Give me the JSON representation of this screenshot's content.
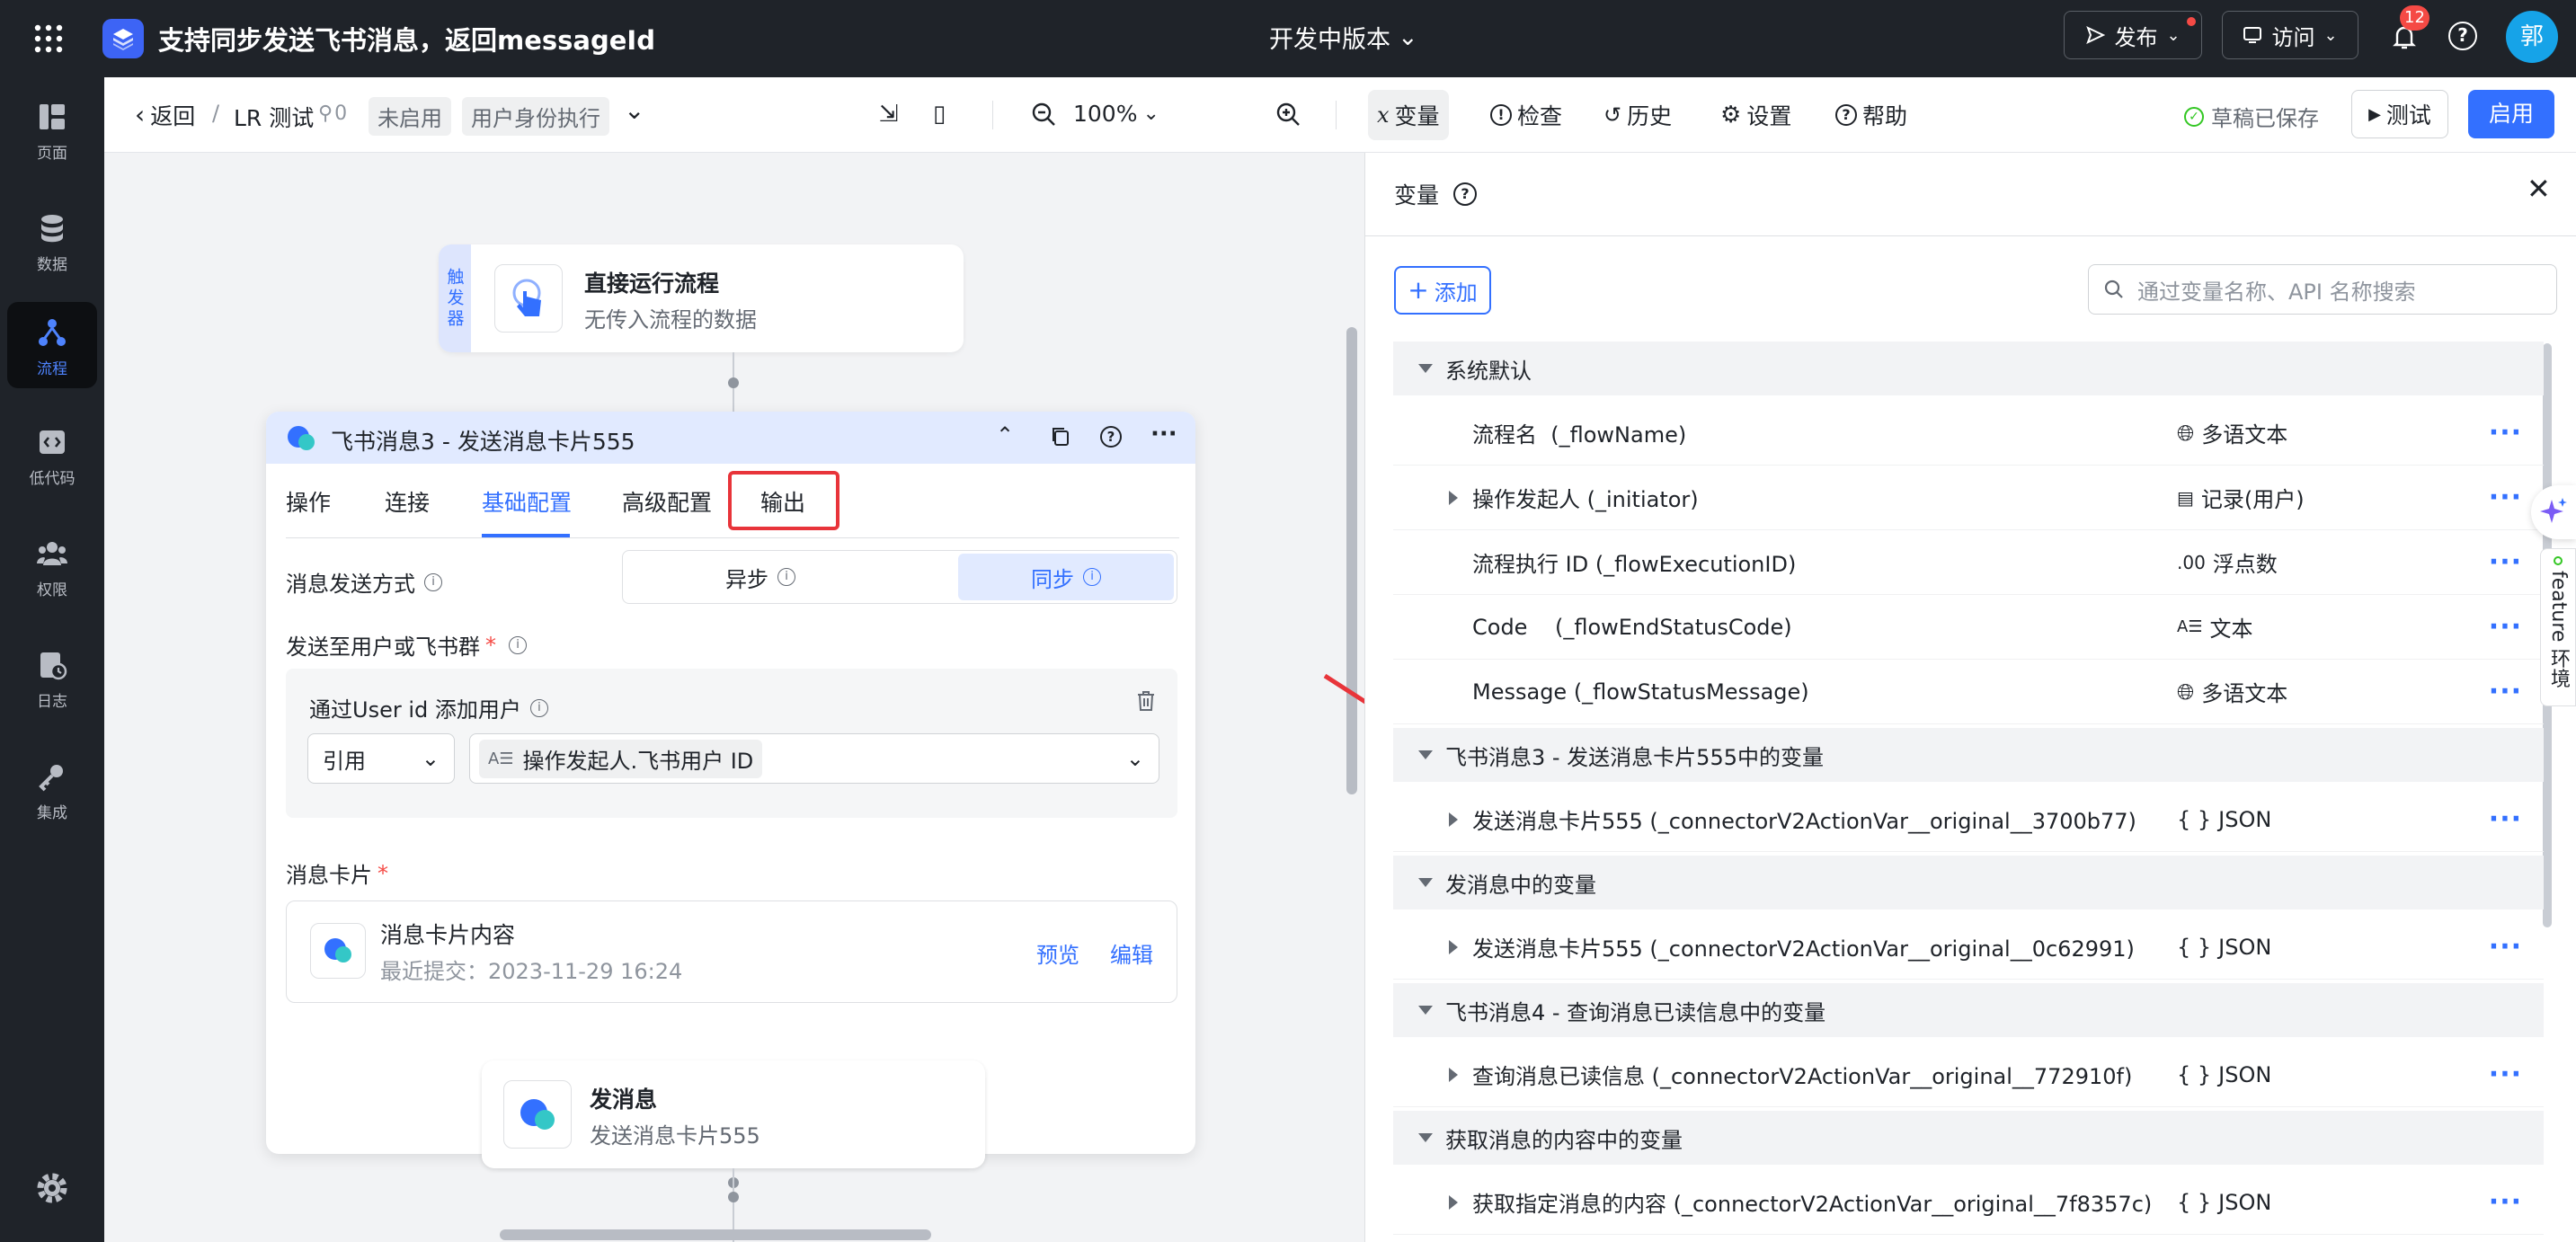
{
  "app": {
    "title": "支持同步发送飞书消息，返回messageId",
    "version_label": "开发中版本",
    "publish_label": "发布",
    "visit_label": "访问",
    "notification_count": "12",
    "avatar_text": "郭"
  },
  "sidebar": {
    "items": [
      {
        "label": "页面",
        "icon": "page-icon"
      },
      {
        "label": "数据",
        "icon": "database-icon"
      },
      {
        "label": "流程",
        "icon": "flow-icon"
      },
      {
        "label": "低代码",
        "icon": "code-icon"
      },
      {
        "label": "权限",
        "icon": "users-icon"
      },
      {
        "label": "日志",
        "icon": "log-icon"
      },
      {
        "label": "集成",
        "icon": "key-icon"
      }
    ]
  },
  "toolbar": {
    "back_label": "返回",
    "breadcrumb_sep": "/",
    "flow_name": "LR 测试",
    "link_count": "0",
    "status_tag": "未启用",
    "exec_tag": "用户身份执行",
    "zoom": "100%",
    "variables": "变量",
    "check": "检查",
    "history": "历史",
    "settings": "设置",
    "help": "帮助",
    "saved": "草稿已保存",
    "test": "测试",
    "enable": "启用"
  },
  "canvas": {
    "trigger_badge": "触发器",
    "trigger_title": "直接运行流程",
    "trigger_sub": "无传入流程的数据",
    "node_title": "飞书消息3 - 发送消息卡片555",
    "tabs": [
      "操作",
      "连接",
      "基础配置",
      "高级配置",
      "输出"
    ],
    "send_mode_label": "消息发送方式",
    "mode_async": "异步",
    "mode_sync": "同步",
    "send_to_label": "发送至用户或飞书群",
    "required_mark": "*",
    "add_user_label": "通过User id 添加用户",
    "ref_select": "引用",
    "ref_value": "操作发起人.飞书用户 ID",
    "card_label": "消息卡片",
    "card_title": "消息卡片内容",
    "card_sub": "最近提交：2023-11-29 16:24",
    "preview": "预览",
    "edit": "编辑",
    "next_title": "发消息",
    "next_sub": "发送消息卡片555"
  },
  "panel": {
    "title": "变量",
    "add_label": "添加",
    "search_placeholder": "通过变量名称、API 名称搜索",
    "groups": [
      {
        "label": "系统默认"
      },
      {
        "label": "飞书消息3 - 发送消息卡片555中的变量"
      },
      {
        "label": "发消息中的变量"
      },
      {
        "label": "飞书消息4 - 查询消息已读信息中的变量"
      },
      {
        "label": "获取消息的内容中的变量"
      }
    ],
    "rows": [
      {
        "name": "流程名  (_flowName)",
        "type": "多语文本",
        "icon": "globe-icon",
        "expand": false
      },
      {
        "name": "操作发起人 (_initiator)",
        "type": "记录(用户)",
        "icon": "record-icon",
        "expand": true
      },
      {
        "name": "流程执行 ID (_flowExecutionID)",
        "type": "浮点数",
        "icon": "decimal-icon",
        "expand": false
      },
      {
        "name": "Code    (_flowEndStatusCode)",
        "type": "文本",
        "icon": "text-icon",
        "expand": false
      },
      {
        "name": "Message (_flowStatusMessage)",
        "type": "多语文本",
        "icon": "globe-icon",
        "expand": false
      },
      {
        "name": "发送消息卡片555 (_connectorV2ActionVar__original__3700b77)",
        "type": "JSON",
        "icon": "json-icon",
        "expand": true
      },
      {
        "name": "发送消息卡片555 (_connectorV2ActionVar__original__0c62991)",
        "type": "JSON",
        "icon": "json-icon",
        "expand": true
      },
      {
        "name": "查询消息已读信息 (_connectorV2ActionVar__original__772910f)",
        "type": "JSON",
        "icon": "json-icon",
        "expand": true
      },
      {
        "name": "获取指定消息的内容 (_connectorV2ActionVar__original__7f8357c)",
        "type": "JSON",
        "icon": "json-icon",
        "expand": true
      }
    ],
    "more_label": "···",
    "decimal_prefix": ".00",
    "json_prefix": "{ }"
  },
  "feature_tab": "feature 环境",
  "colors": {
    "primary": "#3370ff",
    "highlight": "#e8343a",
    "success": "#34c724"
  }
}
